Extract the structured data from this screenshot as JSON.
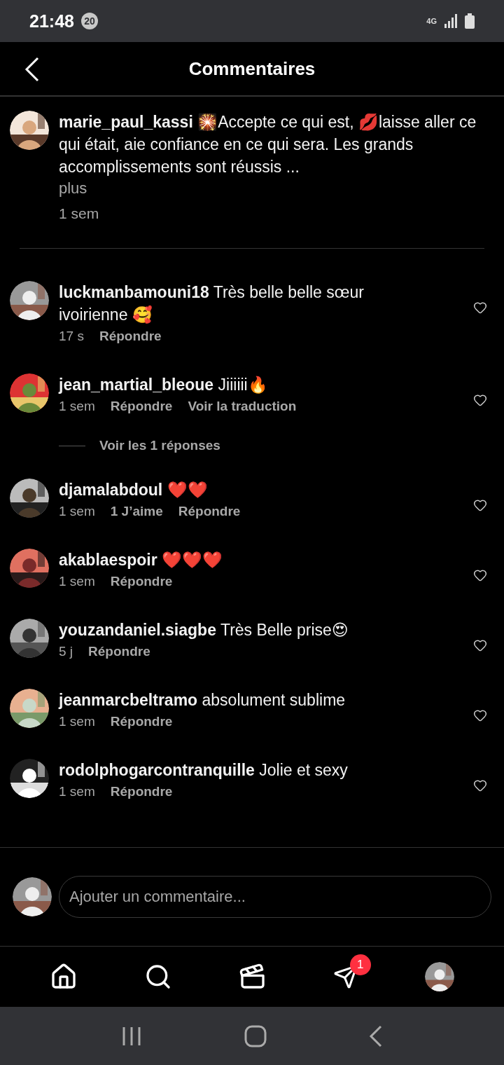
{
  "status_bar": {
    "time": "21:48",
    "notification_count": "20",
    "network": "4G"
  },
  "header": {
    "title": "Commentaires"
  },
  "caption": {
    "username": "marie_paul_kassi",
    "text": "🎇Accepte ce qui est, 💋laisse aller ce qui était, aie confiance en ce qui sera. Les grands accomplissements sont réussis ...",
    "more": "plus",
    "time": "1 sem"
  },
  "comments": [
    {
      "kind": "comment",
      "username": "luckmanbamouni18",
      "text": "Très belle belle sœur ivoirienne 🥰",
      "time": "17 s",
      "reply": "Répondre"
    },
    {
      "kind": "comment",
      "username": "jean_martial_bleoue",
      "text": "Jiiiiii🔥",
      "time": "1 sem",
      "reply": "Répondre",
      "translate": "Voir la traduction"
    },
    {
      "kind": "replies",
      "label": "Voir les 1 réponses"
    },
    {
      "kind": "comment",
      "username": "djamalabdoul",
      "text": "❤️❤️",
      "time": "1 sem",
      "likes": "1 J’aime",
      "reply": "Répondre"
    },
    {
      "kind": "comment",
      "username": "akablaespoir",
      "text": "❤️❤️❤️",
      "time": "1 sem",
      "reply": "Répondre"
    },
    {
      "kind": "comment",
      "username": "youzandaniel.siagbe",
      "text": "Très Belle prise😍",
      "time": "5 j",
      "reply": "Répondre"
    },
    {
      "kind": "comment",
      "username": "jeanmarcbeltramo",
      "text": "absolument sublime",
      "time": "1 sem",
      "reply": "Répondre"
    },
    {
      "kind": "comment",
      "username": "rodolphogarcontranquille",
      "text": "Jolie et sexy",
      "time": "1 sem",
      "reply": "Répondre"
    }
  ],
  "composer": {
    "placeholder": "Ajouter un commentaire..."
  },
  "bottom_nav": {
    "messages_badge": "1"
  }
}
